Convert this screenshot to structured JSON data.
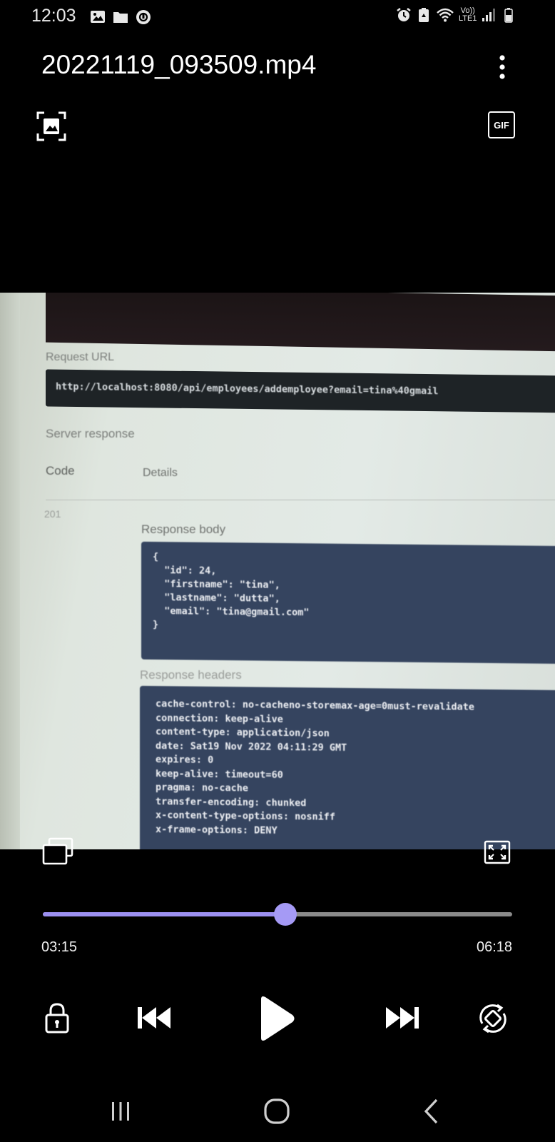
{
  "status_bar": {
    "time": "12:03",
    "network_line1": "Vo))",
    "network_line2": "LTE1"
  },
  "header": {
    "title": "20221119_093509.mp4",
    "gif_label": "GIF",
    "icons": [
      "capture-frame-icon",
      "more-options-icon"
    ]
  },
  "video_frame": {
    "request_url_label": "Request URL",
    "request_url": "http://localhost:8080/api/employees/addemployee?email=tina%40gmail",
    "server_response_label": "Server response",
    "code_header": "Code",
    "details_header": "Details",
    "code_value": "201",
    "response_body_label": "Response body",
    "response_body": "{\n  \"id\": 24,\n  \"firstname\": \"tina\",\n  \"lastname\": \"dutta\",\n  \"email\": \"tina@gmail.com\"\n}",
    "response_headers_label": "Response headers",
    "response_headers": "cache-control: no-cacheno-storemax-age=0must-revalidate\nconnection: keep-alive\ncontent-type: application/json\ndate: Sat19 Nov 2022 04:11:29 GMT\nexpires: 0\nkeep-alive: timeout=60\npragma: no-cache\ntransfer-encoding: chunked\nx-content-type-options: nosniff\nx-frame-options: DENY"
  },
  "player": {
    "current_time": "03:15",
    "total_time": "06:18",
    "progress": 0.516,
    "accent_color": "#9b8ff0",
    "controls": [
      "lock-icon",
      "previous-icon",
      "play-icon",
      "next-icon",
      "rotate-icon"
    ]
  },
  "nav_bar": {
    "buttons": [
      "recents-icon",
      "home-icon",
      "back-icon"
    ]
  }
}
